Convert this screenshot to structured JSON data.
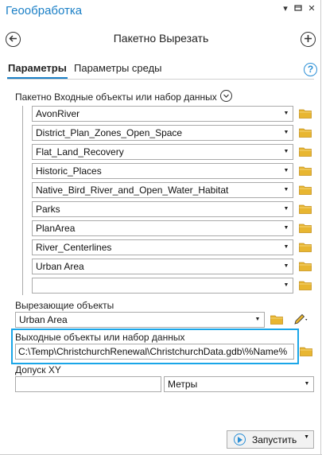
{
  "pane": {
    "title": "Геообработка",
    "pin_glyph": "▾",
    "autohide_glyph": "⊣",
    "close_glyph": "✕"
  },
  "tool": {
    "title": "Пакетно Вырезать",
    "back_glyph": "←",
    "add_glyph": "+"
  },
  "tabs": [
    {
      "label": "Параметры",
      "active": true
    },
    {
      "label": "Параметры среды",
      "active": false
    }
  ],
  "help_glyph": "?",
  "batch_input": {
    "label": "Пакетно Входные объекты или набор данных",
    "expand_glyph": "⌄",
    "items": [
      "AvonRiver",
      "District_Plan_Zones_Open_Space",
      "Flat_Land_Recovery",
      "Historic_Places",
      "Native_Bird_River_and_Open_Water_Habitat",
      "Parks",
      "PlanArea",
      "River_Centerlines",
      "Urban Area",
      ""
    ]
  },
  "clip_features": {
    "label": "Вырезающие объекты",
    "value": "Urban Area"
  },
  "output": {
    "label": "Выходные объекты или набор данных",
    "value": "C:\\Temp\\ChristchurchRenewal\\ChristchurchData.gdb\\%Name%"
  },
  "xy_tolerance": {
    "label": "Допуск XY",
    "value": "",
    "units": "Метры"
  },
  "run_button": {
    "label": "Запустить"
  },
  "colors": {
    "accent": "#1a7fc6",
    "highlight": "#1aa6e8",
    "folder": "#e8b631"
  }
}
